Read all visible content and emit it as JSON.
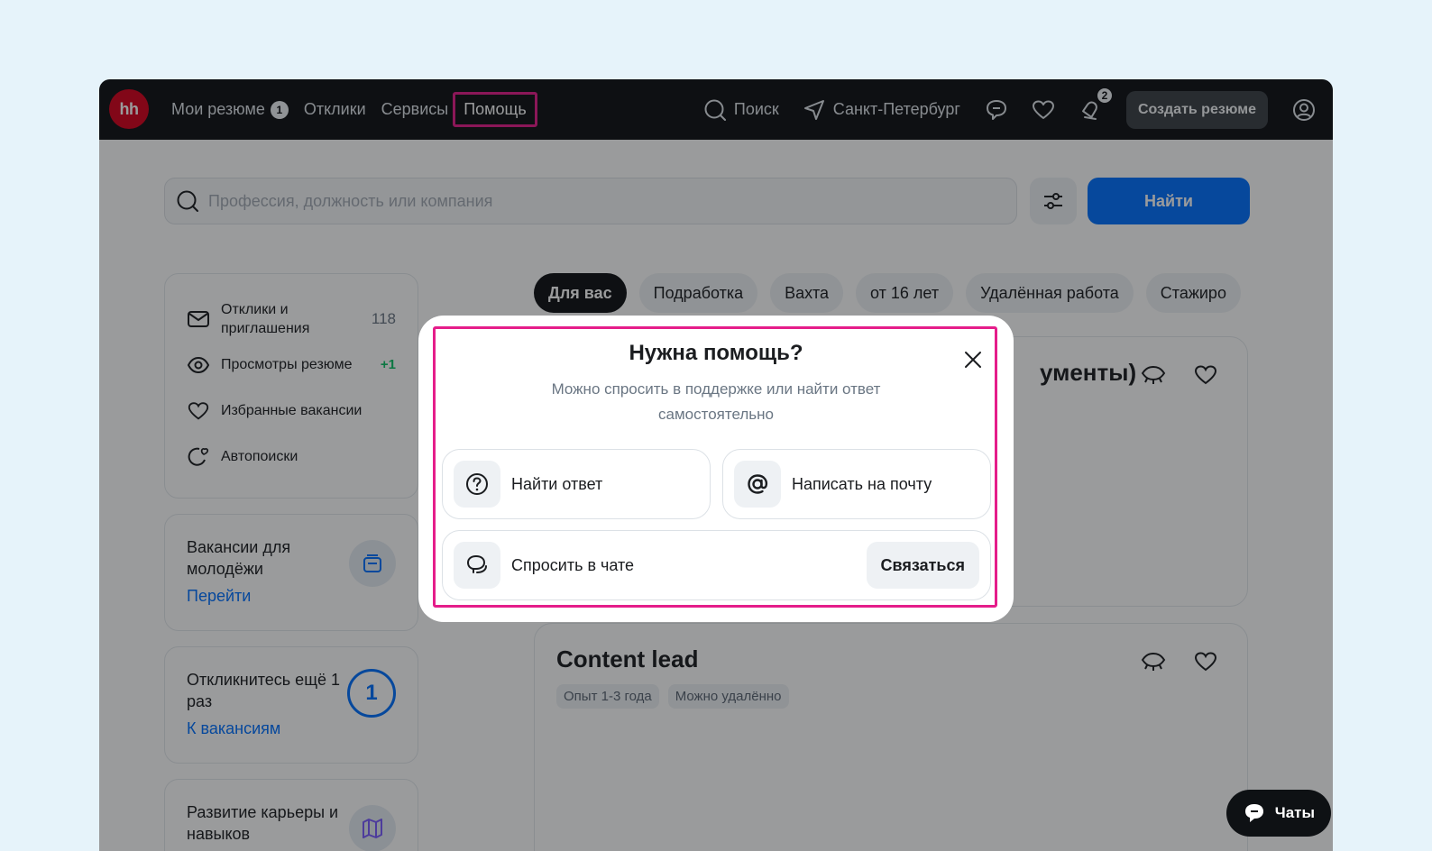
{
  "header": {
    "logo_text": "hh",
    "nav": {
      "resumes_label": "Мои резюме",
      "resumes_badge": "1",
      "responses_label": "Отклики",
      "services_label": "Сервисы",
      "help_label": "Помощь"
    },
    "search_label": "Поиск",
    "city_label": "Санкт-Петербург",
    "notifications_badge": "2",
    "create_resume_label": "Создать резюме"
  },
  "search": {
    "placeholder": "Профессия, должность или компания",
    "find_label": "Найти"
  },
  "sidebar": {
    "items": [
      {
        "label": "Отклики и приглашения",
        "count": "118"
      },
      {
        "label": "Просмотры резюме",
        "count": "+1"
      },
      {
        "label": "Избранные вакансии",
        "count": ""
      },
      {
        "label": "Автопоиски",
        "count": ""
      }
    ],
    "youth_card": {
      "title": "Вакансии для молодёжи",
      "link": "Перейти"
    },
    "respond_card": {
      "title": "Откликнитесь ещё 1 раз",
      "count": "1",
      "link": "К вакансиям"
    },
    "career_card": {
      "title": "Развитие карьеры и навыков"
    }
  },
  "chips": [
    "Для вас",
    "Подработка",
    "Вахта",
    "от 16 лет",
    "Удалённая работа",
    "Стажиро"
  ],
  "vacancies": [
    {
      "title_fragment": "ументы)"
    },
    {
      "title": "Content lead",
      "tags": [
        "Опыт 1-3 года",
        "Можно удалённо"
      ]
    }
  ],
  "chats_label": "Чаты",
  "modal": {
    "title": "Нужна помощь?",
    "subtitle": "Можно спросить в поддержке или найти ответ самостоятельно",
    "options": {
      "find_answer": "Найти ответ",
      "email": "Написать на почту",
      "chat": "Спросить в чате",
      "contact_button": "Связаться"
    }
  },
  "colors": {
    "brand_red": "#d6001c",
    "primary_blue": "#0070ff",
    "highlight_pink": "#e51d8a",
    "header_bg": "#0e1114"
  }
}
